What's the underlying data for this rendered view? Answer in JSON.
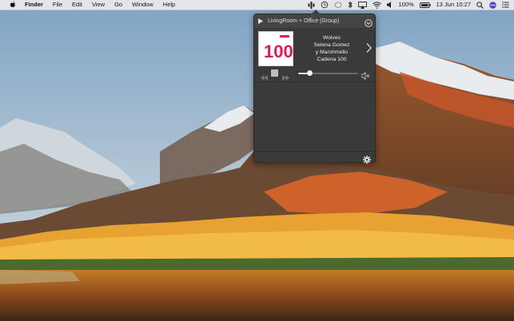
{
  "menubar": {
    "app_name": "Finder",
    "menus": [
      "File",
      "Edit",
      "View",
      "Go",
      "Window",
      "Help"
    ],
    "battery": "100%",
    "datetime": "13 Jun  10:27",
    "icons": [
      "sonos-icon",
      "time-machine-icon",
      "bluetooth-icon",
      "airplay-icon",
      "wifi-icon",
      "volume-icon",
      "battery-icon",
      "spotlight-icon",
      "siri-icon",
      "notification-center-icon"
    ]
  },
  "player": {
    "group_title": "LivingRoom + Office (Group)",
    "track": {
      "title": "Wolves",
      "artist_line1": "Selena Gomez",
      "artist_line2": "y Marshmello",
      "station": "Cadena 100"
    },
    "artwork_label": "100",
    "volume": 0.18
  },
  "colors": {
    "popover_bg": "#3a3a3a",
    "artwork_red": "#d91c5c"
  }
}
